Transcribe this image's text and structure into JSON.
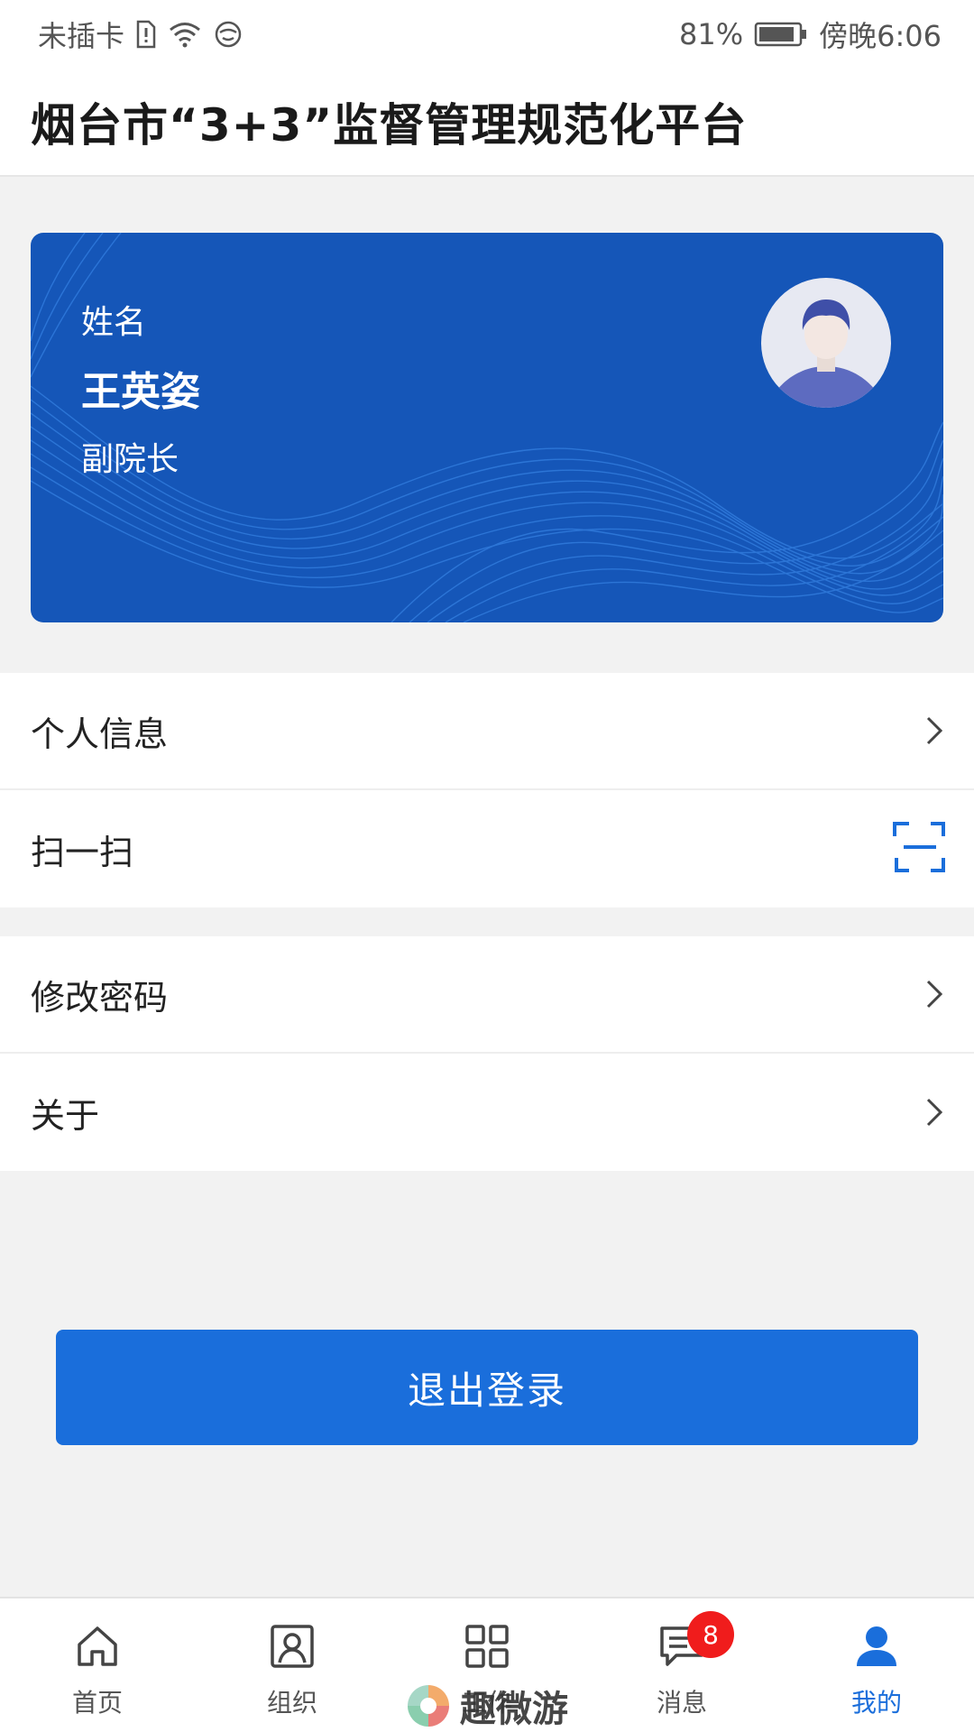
{
  "status_bar": {
    "carrier": "未插卡",
    "battery": "81%",
    "time": "傍晚6:06"
  },
  "header": {
    "title": "烟台市“3+3”监督管理规范化平台"
  },
  "profile": {
    "name_label": "姓名",
    "name": "王英姿",
    "role": "副院长"
  },
  "menu": {
    "personal_info": "个人信息",
    "scan": "扫一扫",
    "change_password": "修改密码",
    "about": "关于"
  },
  "logout_label": "退出登录",
  "tabs": [
    {
      "label": "首页",
      "icon": "home-icon"
    },
    {
      "label": "组织",
      "icon": "org-icon"
    },
    {
      "label": "工作",
      "icon": "grid-icon"
    },
    {
      "label": "消息",
      "icon": "message-icon",
      "badge": "8"
    },
    {
      "label": "我的",
      "icon": "user-icon",
      "active": true
    }
  ],
  "watermark": "趣微游",
  "colors": {
    "primary": "#1a6edb",
    "card": "#1556b8",
    "badge": "#f01c1c"
  }
}
